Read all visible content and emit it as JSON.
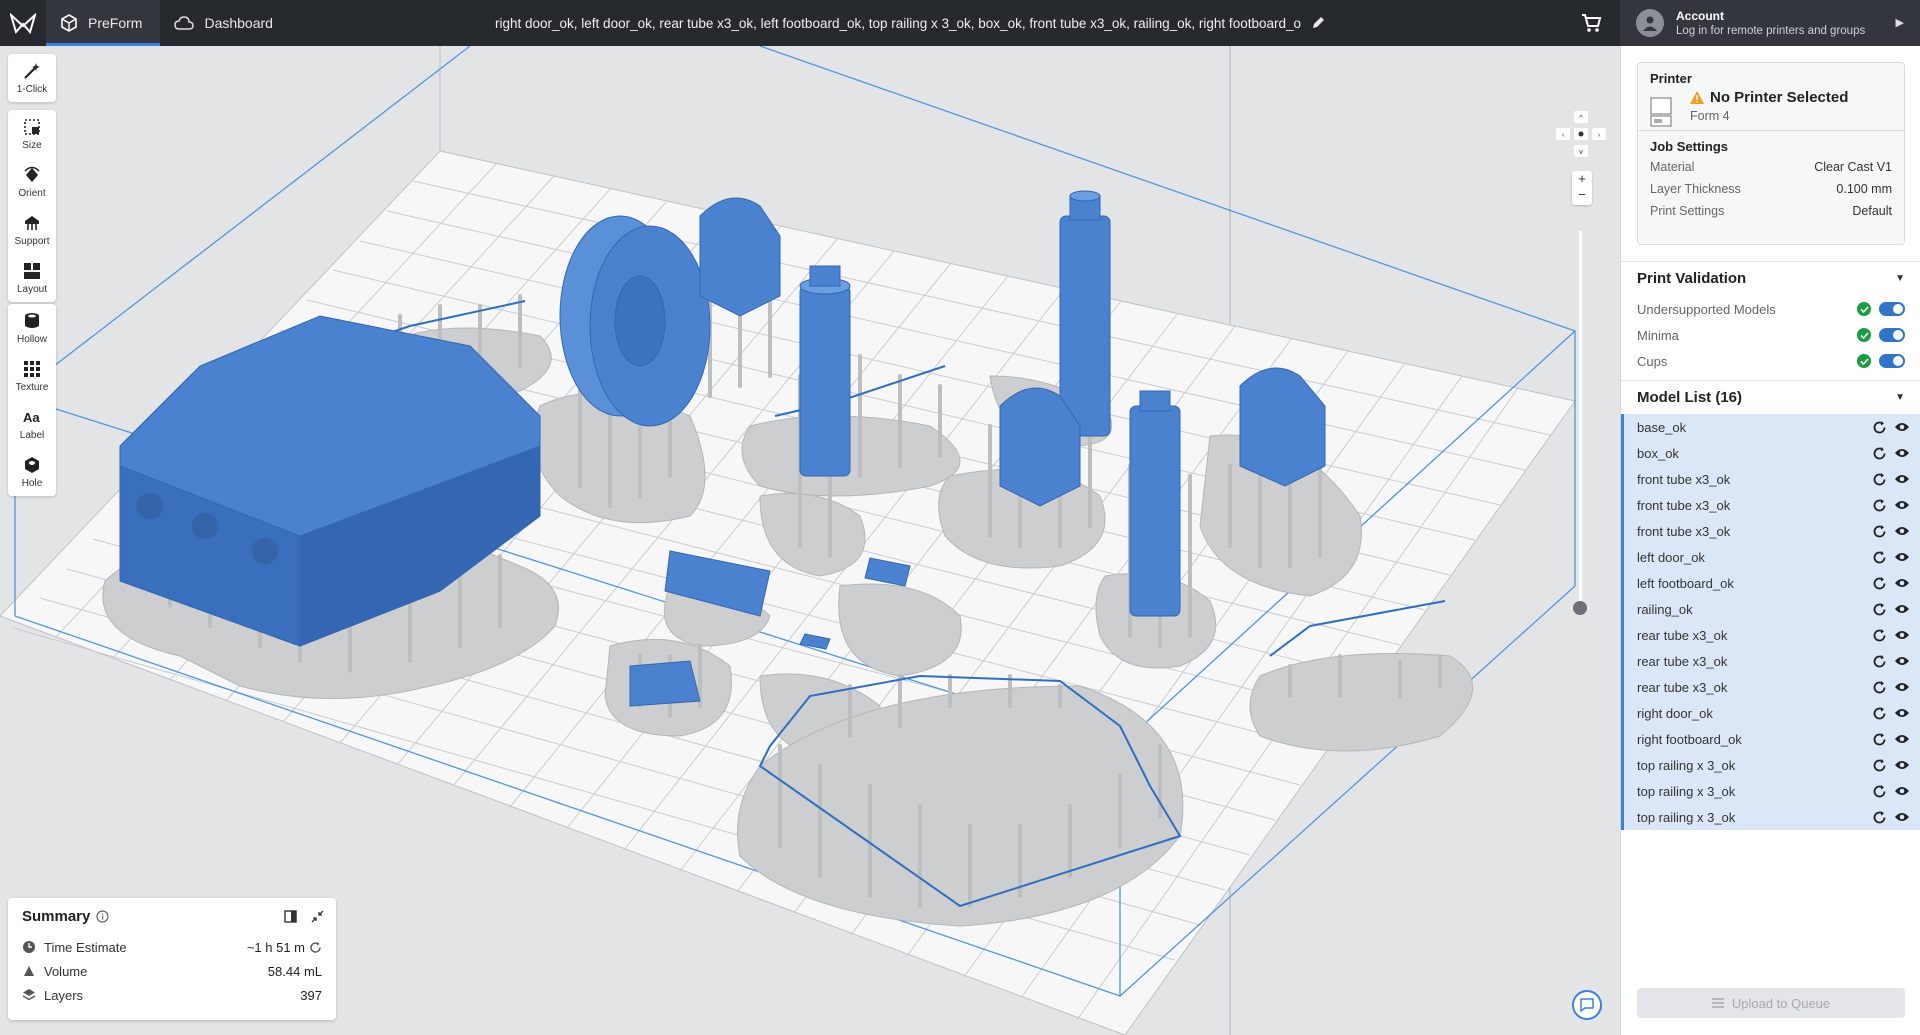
{
  "topbar": {
    "tabs": [
      {
        "label": "PreForm",
        "icon": "preform-icon"
      },
      {
        "label": "Dashboard",
        "icon": "cloud-icon"
      }
    ],
    "document_title": "right door_ok, left door_ok, rear tube x3_ok, left footboard_ok, top railing x 3_ok, box_ok, front tube x3_ok, railing_ok, right footboard_o",
    "account": {
      "title": "Account",
      "subtitle": "Log in for remote printers and groups"
    }
  },
  "tools": {
    "group1": [
      {
        "label": "1-Click",
        "icon": "magic-wand-icon"
      }
    ],
    "group2": [
      {
        "label": "Size",
        "icon": "size-icon"
      },
      {
        "label": "Orient",
        "icon": "orient-icon"
      },
      {
        "label": "Support",
        "icon": "support-icon"
      },
      {
        "label": "Layout",
        "icon": "layout-icon"
      }
    ],
    "group3": [
      {
        "label": "Hollow",
        "icon": "hollow-icon"
      },
      {
        "label": "Texture",
        "icon": "texture-icon"
      },
      {
        "label": "Label",
        "icon": "label-icon"
      },
      {
        "label": "Hole",
        "icon": "hole-icon"
      }
    ]
  },
  "viewport": {
    "zoom_in": "+",
    "zoom_out": "−"
  },
  "summary": {
    "title": "Summary",
    "rows": [
      {
        "label": "Time Estimate",
        "value": "~1 h 51 m",
        "icon": "clock-icon"
      },
      {
        "label": "Volume",
        "value": "58.44 mL",
        "icon": "volume-icon"
      },
      {
        "label": "Layers",
        "value": "397",
        "icon": "layers-icon"
      }
    ]
  },
  "printer": {
    "section_label": "Printer",
    "name": "No Printer Selected",
    "model": "Form 4",
    "job_settings_label": "Job Settings",
    "settings": [
      {
        "label": "Material",
        "value": "Clear Cast V1"
      },
      {
        "label": "Layer Thickness",
        "value": "0.100 mm"
      },
      {
        "label": "Print Settings",
        "value": "Default"
      }
    ]
  },
  "validation": {
    "title": "Print Validation",
    "items": [
      {
        "label": "Undersupported Models",
        "enabled": true
      },
      {
        "label": "Minima",
        "enabled": true
      },
      {
        "label": "Cups",
        "enabled": true
      }
    ]
  },
  "model_list": {
    "title": "Model List (16)",
    "items": [
      "base_ok",
      "box_ok",
      "front tube x3_ok",
      "front tube x3_ok",
      "front tube x3_ok",
      "left door_ok",
      "left footboard_ok",
      "railing_ok",
      "rear tube x3_ok",
      "rear tube x3_ok",
      "rear tube x3_ok",
      "right door_ok",
      "right footboard_ok",
      "top railing x 3_ok",
      "top railing x 3_ok",
      "top railing x 3_ok"
    ]
  },
  "upload_button": "Upload to Queue",
  "colors": {
    "accent": "#3b82e0",
    "model_blue": "#4a82cf",
    "support_gray": "#cfd0d3",
    "topbar": "#26292e"
  }
}
